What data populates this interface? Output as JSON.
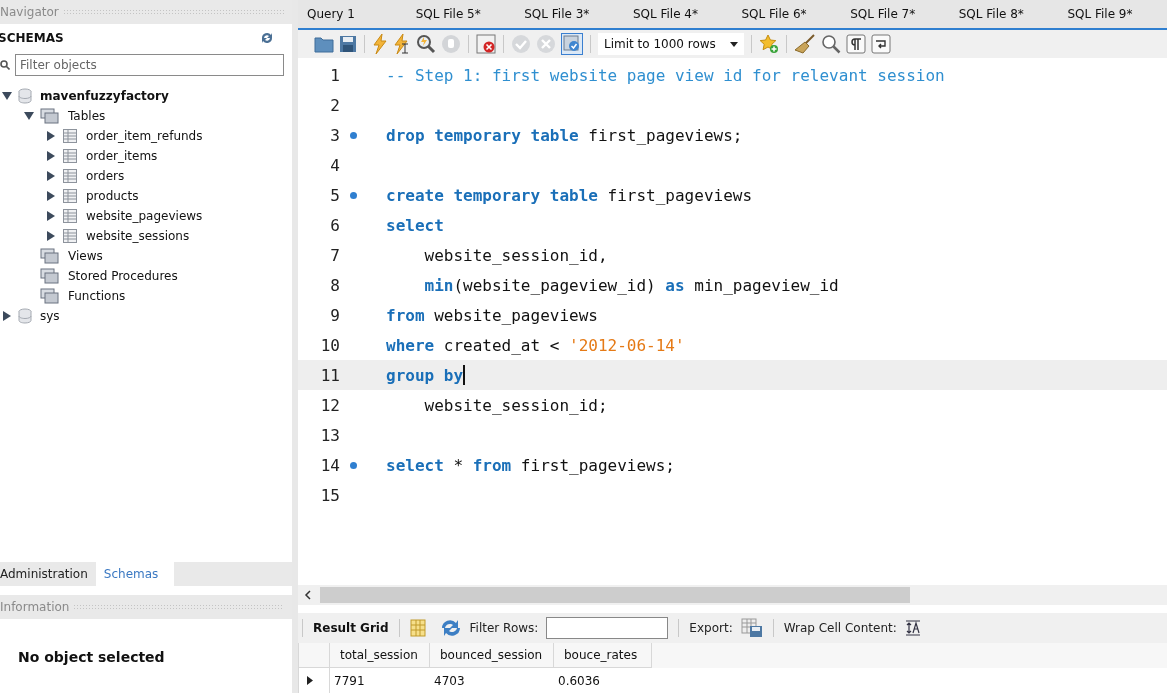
{
  "navigator": {
    "title": "Navigator",
    "schemas_label": "SCHEMAS",
    "filter": {
      "placeholder": "Filter objects"
    },
    "tree": [
      {
        "label": "mavenfuzzyfactory",
        "kind": "schema",
        "expanded": true,
        "children": [
          {
            "label": "Tables",
            "kind": "group",
            "expanded": true,
            "children": [
              {
                "label": "order_item_refunds",
                "kind": "table",
                "expanded": false
              },
              {
                "label": "order_items",
                "kind": "table",
                "expanded": false
              },
              {
                "label": "orders",
                "kind": "table",
                "expanded": false
              },
              {
                "label": "products",
                "kind": "table",
                "expanded": false
              },
              {
                "label": "website_pageviews",
                "kind": "table",
                "expanded": false
              },
              {
                "label": "website_sessions",
                "kind": "table",
                "expanded": false
              }
            ]
          },
          {
            "label": "Views",
            "kind": "group",
            "expanded": false
          },
          {
            "label": "Stored Procedures",
            "kind": "group",
            "expanded": false
          },
          {
            "label": "Functions",
            "kind": "group",
            "expanded": false
          }
        ]
      },
      {
        "label": "sys",
        "kind": "schema",
        "expanded": false
      }
    ],
    "bottom_tabs": [
      {
        "label": "Administration",
        "selected": false
      },
      {
        "label": "Schemas",
        "selected": true
      }
    ],
    "information": {
      "title": "Information",
      "message": "No object selected"
    }
  },
  "editor_tabs": [
    {
      "label": "Query 1"
    },
    {
      "label": "SQL File 5*"
    },
    {
      "label": "SQL File 3*"
    },
    {
      "label": "SQL File 4*"
    },
    {
      "label": "SQL File 6*"
    },
    {
      "label": "SQL File 7*"
    },
    {
      "label": "SQL File 8*"
    },
    {
      "label": "SQL File 9*"
    }
  ],
  "toolbar": {
    "limit": "Limit to 1000 rows",
    "autocommit": true
  },
  "code": [
    {
      "number": "1",
      "marker": false,
      "current": false,
      "tokens": [
        {
          "kind": "comment",
          "text": "-- Step 1: first website page view id for relevant session"
        }
      ]
    },
    {
      "number": "2",
      "marker": false,
      "current": false
    },
    {
      "number": "3",
      "marker": true,
      "current": false,
      "tokens": [
        {
          "kind": "keyword",
          "text": "drop temporary table"
        },
        {
          "kind": "plain",
          "text": " first_pageviews;"
        }
      ]
    },
    {
      "number": "4",
      "marker": false,
      "current": false
    },
    {
      "number": "5",
      "marker": true,
      "current": false,
      "tokens": [
        {
          "kind": "keyword",
          "text": "create temporary table"
        },
        {
          "kind": "plain",
          "text": " first_pageviews"
        }
      ]
    },
    {
      "number": "6",
      "marker": false,
      "current": false,
      "tokens": [
        {
          "kind": "keyword",
          "text": "select"
        }
      ]
    },
    {
      "number": "7",
      "marker": false,
      "current": false,
      "indented": true,
      "tokens": [
        {
          "kind": "plain",
          "text": "website_session_id,"
        }
      ]
    },
    {
      "number": "8",
      "marker": false,
      "current": false,
      "indented": true,
      "tokens": [
        {
          "kind": "function",
          "text": "min"
        },
        {
          "kind": "plain",
          "text": "(website_pageview_id) "
        },
        {
          "kind": "keyword",
          "text": "as"
        },
        {
          "kind": "plain",
          "text": " min_pageview_id"
        }
      ]
    },
    {
      "number": "9",
      "marker": false,
      "current": false,
      "tokens": [
        {
          "kind": "keyword",
          "text": "from"
        },
        {
          "kind": "plain",
          "text": " website_pageviews"
        }
      ]
    },
    {
      "number": "10",
      "marker": false,
      "current": false,
      "tokens": [
        {
          "kind": "keyword",
          "text": "where"
        },
        {
          "kind": "plain",
          "text": " created_at < "
        },
        {
          "kind": "string",
          "text": "'2012-06-14'"
        }
      ]
    },
    {
      "number": "11",
      "marker": false,
      "current": true,
      "tokens": [
        {
          "kind": "keyword",
          "text": "group by"
        }
      ]
    },
    {
      "number": "12",
      "marker": false,
      "current": false,
      "indented": true,
      "tokens": [
        {
          "kind": "plain",
          "text": "website_session_id;"
        }
      ]
    },
    {
      "number": "13",
      "marker": false,
      "current": false
    },
    {
      "number": "14",
      "marker": true,
      "current": false,
      "tokens": [
        {
          "kind": "keyword",
          "text": "select"
        },
        {
          "kind": "plain",
          "text": " * "
        },
        {
          "kind": "keyword",
          "text": "from"
        },
        {
          "kind": "plain",
          "text": " first_pageviews;"
        }
      ]
    },
    {
      "number": "15",
      "marker": false,
      "current": false
    }
  ],
  "results": {
    "view_label": "Result Grid",
    "filter_label": "Filter Rows:",
    "export_label": "Export:",
    "wrap_label": "Wrap Cell Content:",
    "columns": [
      "total_session",
      "bounced_session",
      "bouce_rates"
    ],
    "rows": [
      {
        "current": true,
        "cells": [
          "7791",
          "4703",
          "0.6036"
        ]
      }
    ]
  }
}
